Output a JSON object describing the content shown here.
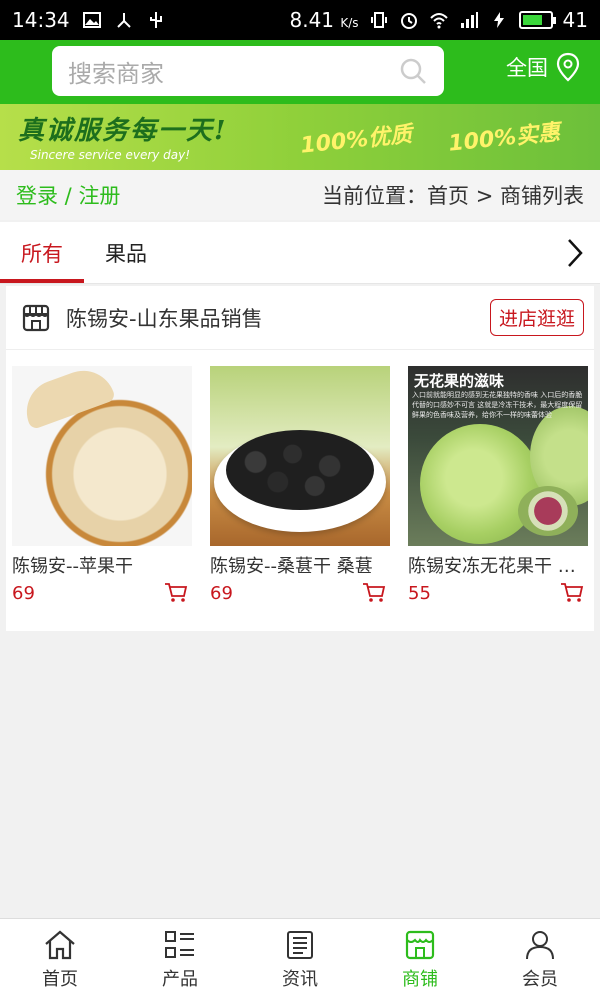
{
  "status_bar": {
    "time": "14:34",
    "speed": "8.41",
    "speed_unit": "K/s",
    "battery": "41",
    "battery_level_pct": 75
  },
  "header": {
    "search_placeholder": "搜索商家",
    "region": "全国"
  },
  "banner": {
    "slogan": "真诚服务每一天!",
    "slogan_en": "Sincere service every day!",
    "tag1": "100%优质",
    "tag2": "100%实惠"
  },
  "crumb": {
    "login": "登录",
    "separator": " / ",
    "register": "注册",
    "location": "当前位置：首页 > 商铺列表"
  },
  "tabs": [
    {
      "label": "所有"
    },
    {
      "label": "果品"
    }
  ],
  "shop": {
    "name": "陈锡安-山东果品销售",
    "visit_label": "进店逛逛",
    "products": [
      {
        "name": "陈锡安--苹果干",
        "price": "69"
      },
      {
        "name": "陈锡安--桑葚干 桑葚",
        "price": "69"
      },
      {
        "name": "陈锡安冻无花果干 无花果",
        "price": "55",
        "image_title": "无花果的滋味",
        "image_text": "入口前就能明显的感到无花果独特的香味 入口后的香脆代替的口感妙不可言 这就是冷冻干技术，最大程度保留鲜果的色香味及营养，给你不一样的味蕾体验"
      }
    ]
  },
  "bottom_nav": [
    {
      "label": "首页",
      "icon": "home-icon"
    },
    {
      "label": "产品",
      "icon": "grid-list-icon"
    },
    {
      "label": "资讯",
      "icon": "news-icon"
    },
    {
      "label": "商铺",
      "icon": "shop-icon"
    },
    {
      "label": "会员",
      "icon": "user-icon"
    }
  ],
  "colors": {
    "brand_green": "#2dbc1c",
    "accent_red": "#c8171e"
  }
}
